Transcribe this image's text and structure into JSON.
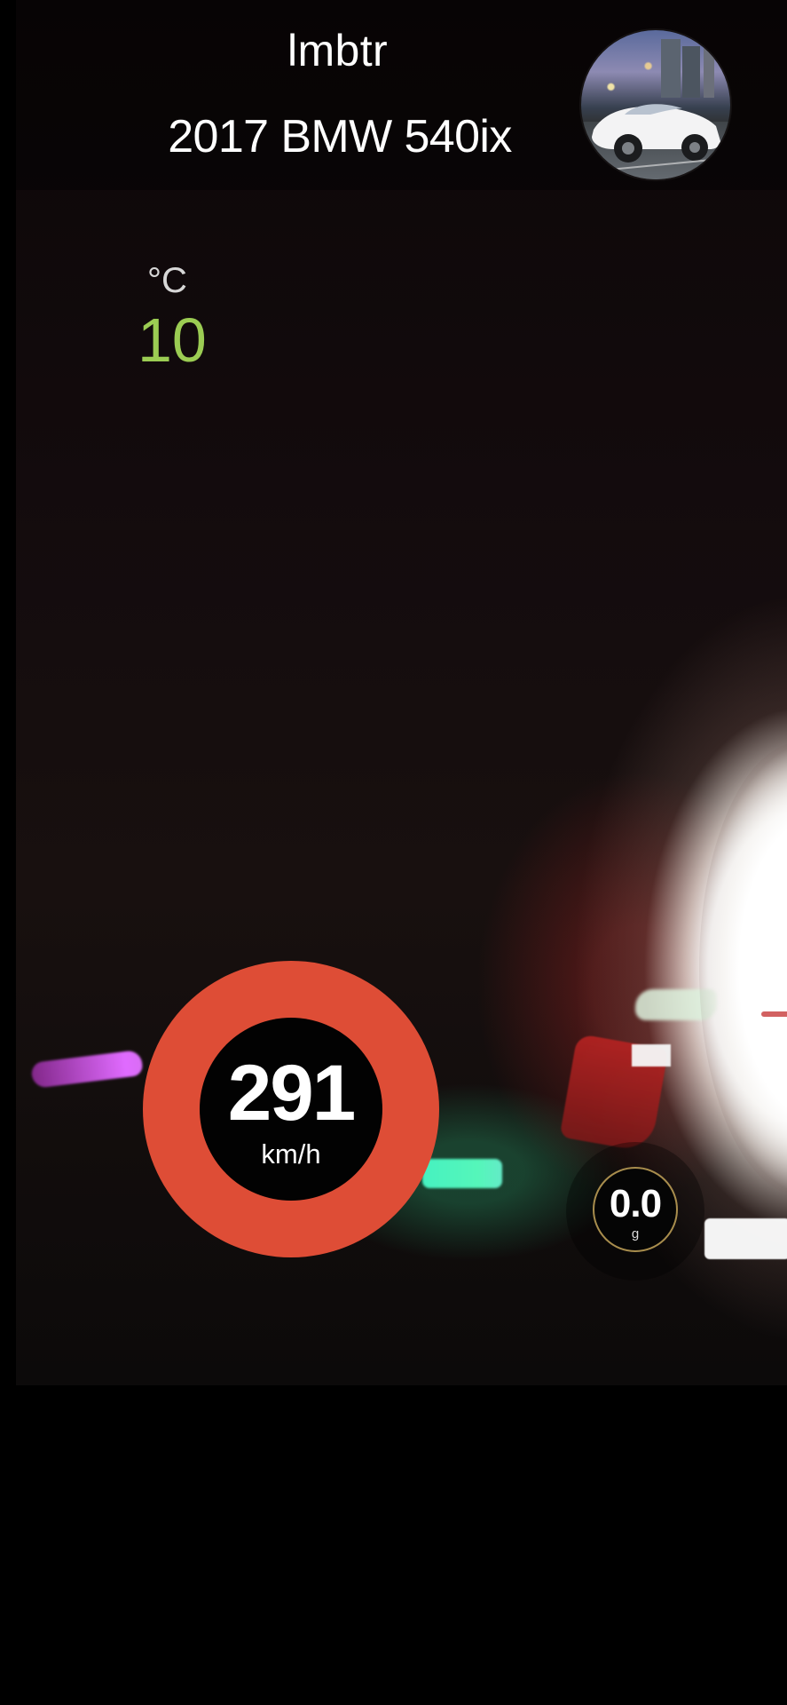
{
  "overlay": {
    "driver_name": "lmbtr",
    "vehicle_name": "2017 BMW 540ix",
    "avatar_icon": "car-photo-icon"
  },
  "temperature": {
    "unit": "°C",
    "value": "10",
    "value_color": "#9bcc53"
  },
  "speed_gauge": {
    "value": "291",
    "unit": "km/h",
    "ring_color": "#de4d36"
  },
  "g_force_gauge": {
    "value": "0.0",
    "unit": "g",
    "ring_color": "#a88d4d"
  }
}
